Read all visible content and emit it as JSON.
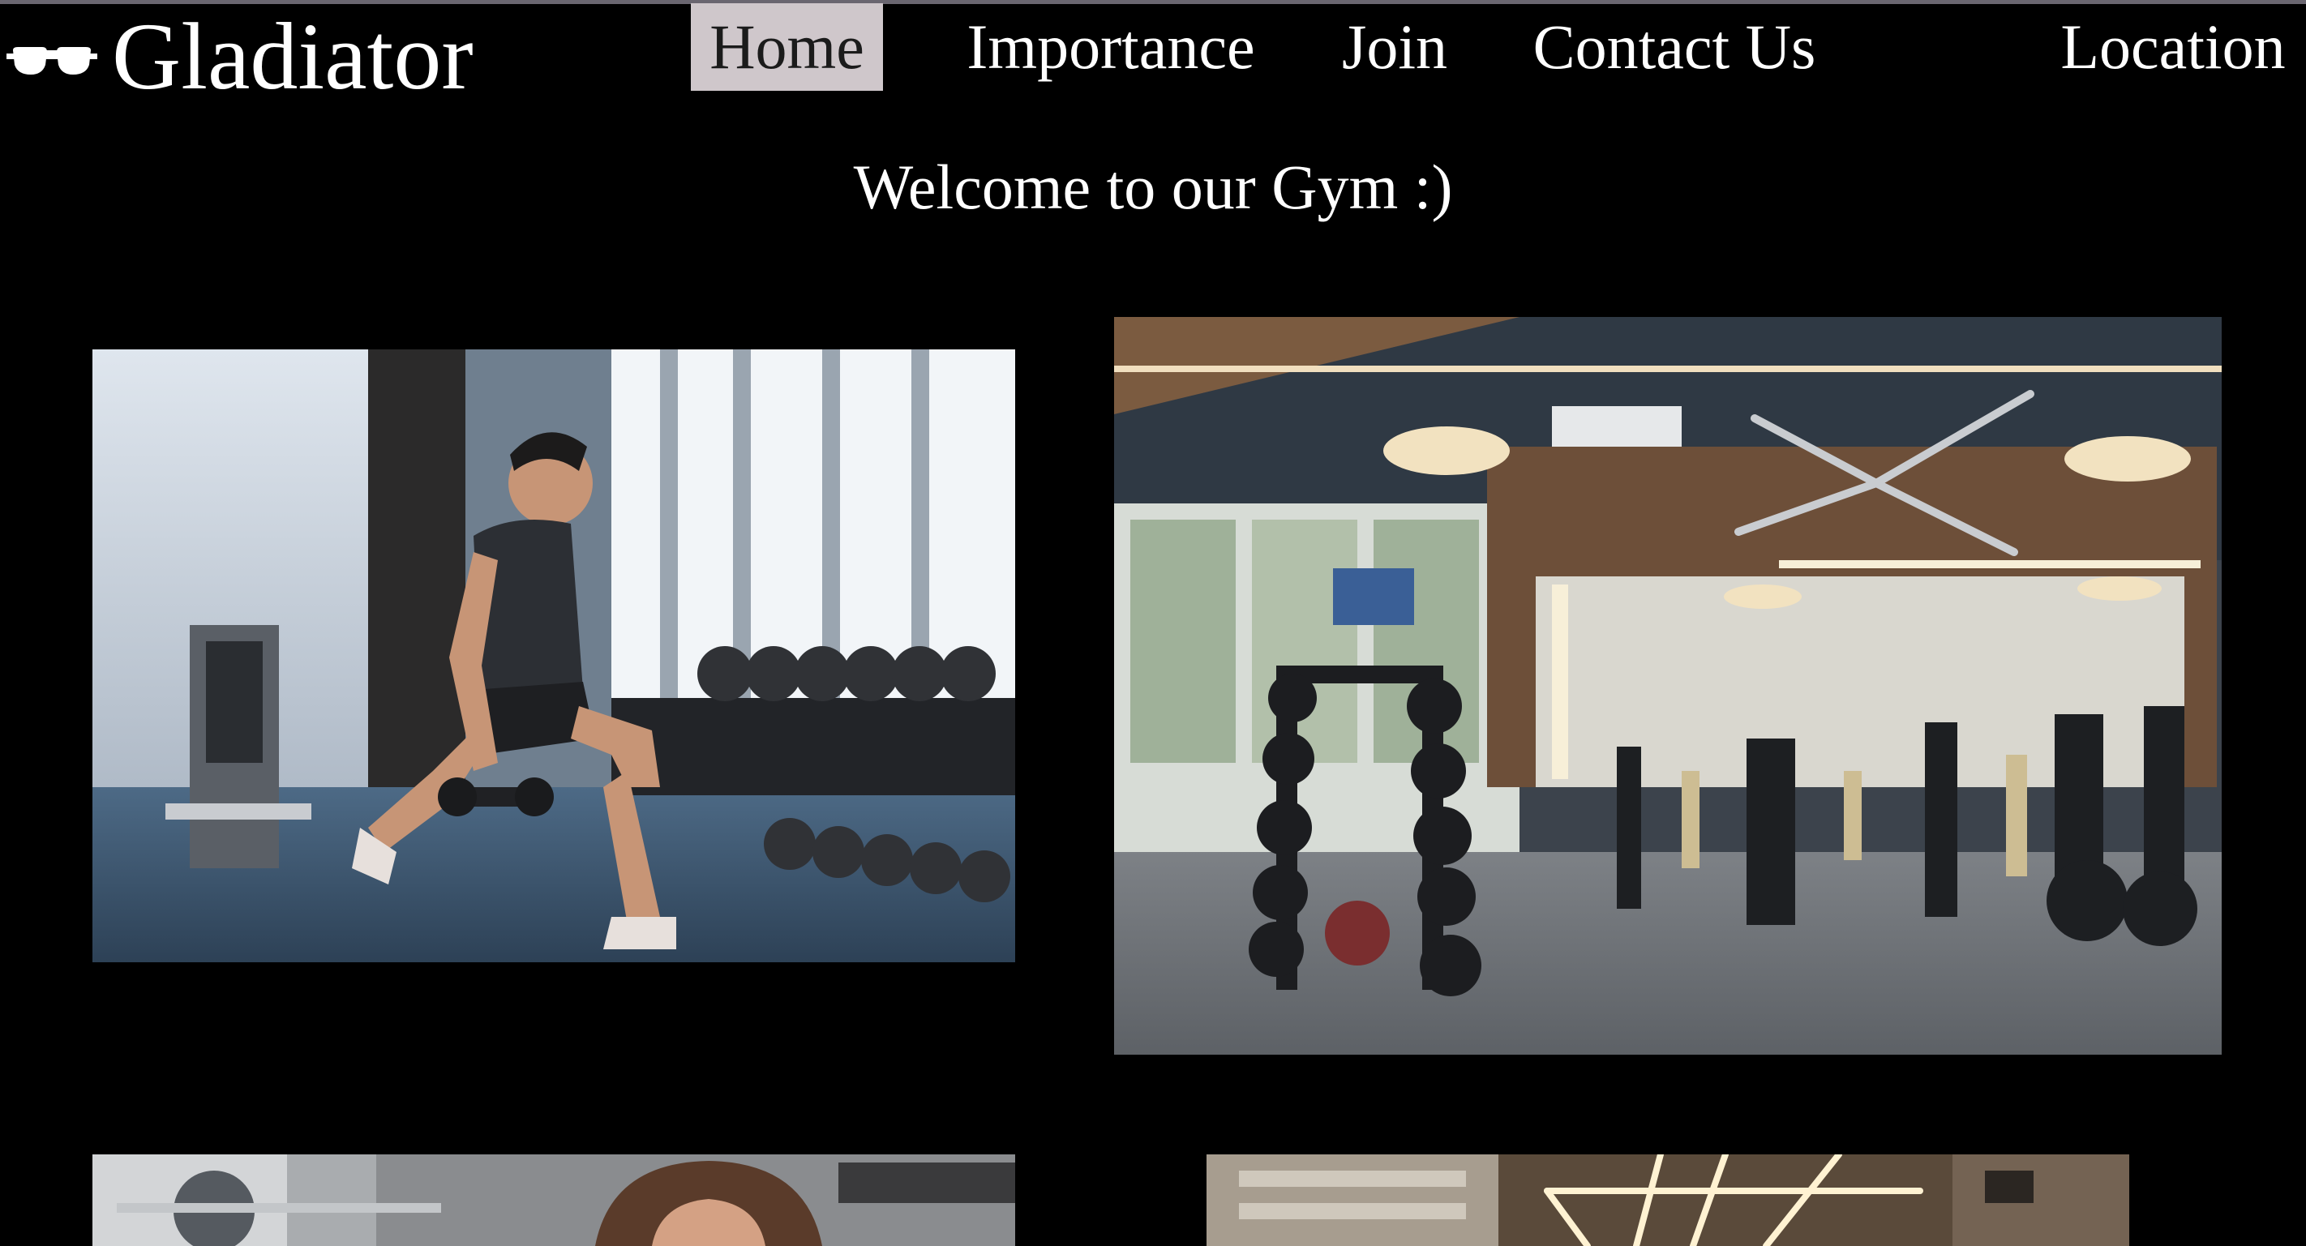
{
  "brand": {
    "name": "Gladiator",
    "icon": "sunglasses-icon"
  },
  "nav": {
    "home": "Home",
    "importance": "Importance",
    "join": "Join",
    "contact": "Contact Us",
    "location": "Location",
    "active": "Home"
  },
  "main": {
    "welcome": "Welcome to our Gym :)"
  },
  "gallery": [
    "man doing dumbbell lunge in gym",
    "gym floor with dumbbell rack and machines",
    "woman working out with dumbbells",
    "gym interior with ceiling lights"
  ],
  "colors": {
    "page_background": "#000000",
    "active_nav_background": "#cfc7cb",
    "active_nav_text": "#1b1b1b",
    "text": "#ffffff"
  }
}
